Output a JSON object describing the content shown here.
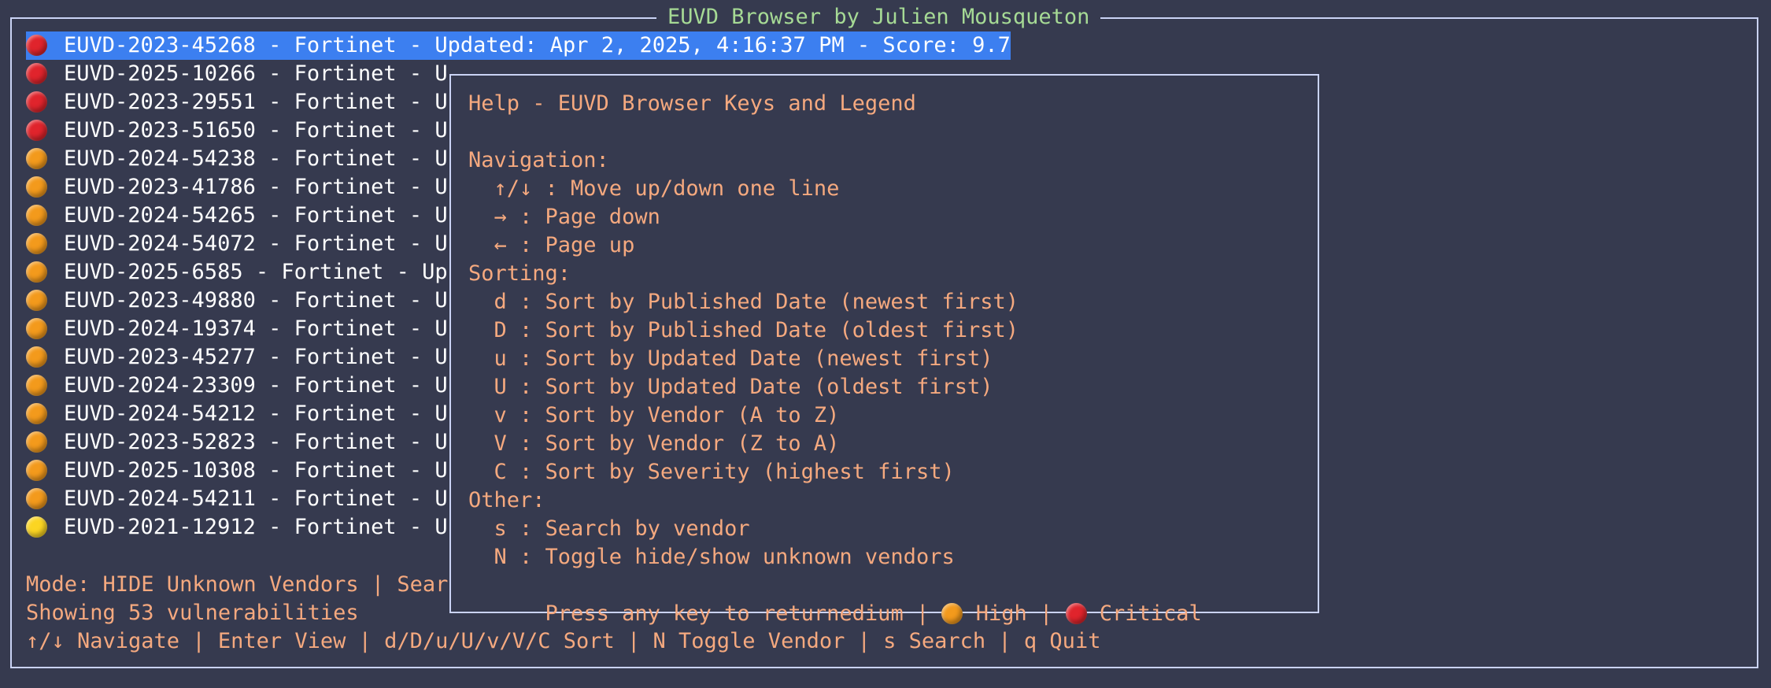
{
  "app": {
    "title": "EUVD Browser by Julien Mousqueton"
  },
  "colors": {
    "background": "#363a4f",
    "title": "#a6da95",
    "accent": "#f5a97f",
    "selection": "#3c7ff0",
    "critical": "#e0242c",
    "high": "#f39a1c",
    "medium": "#fbd522"
  },
  "list": {
    "selected_index": 0,
    "items": [
      {
        "severity": "critical",
        "icon": "red-circle-icon",
        "text": "EUVD-2023-45268 - Fortinet - Updated: Apr 2, 2025, 4:16:37 PM - Score: 9.7"
      },
      {
        "severity": "critical",
        "icon": "red-circle-icon",
        "text": "EUVD-2025-10266 - Fortinet - U"
      },
      {
        "severity": "critical",
        "icon": "red-circle-icon",
        "text": "EUVD-2023-29551 - Fortinet - U"
      },
      {
        "severity": "critical",
        "icon": "red-circle-icon",
        "text": "EUVD-2023-51650 - Fortinet - U"
      },
      {
        "severity": "high",
        "icon": "orange-circle-icon",
        "text": "EUVD-2024-54238 - Fortinet - U"
      },
      {
        "severity": "high",
        "icon": "orange-circle-icon",
        "text": "EUVD-2023-41786 - Fortinet - U"
      },
      {
        "severity": "high",
        "icon": "orange-circle-icon",
        "text": "EUVD-2024-54265 - Fortinet - U"
      },
      {
        "severity": "high",
        "icon": "orange-circle-icon",
        "text": "EUVD-2024-54072 - Fortinet - U"
      },
      {
        "severity": "high",
        "icon": "orange-circle-icon",
        "text": "EUVD-2025-6585 - Fortinet - Up"
      },
      {
        "severity": "high",
        "icon": "orange-circle-icon",
        "text": "EUVD-2023-49880 - Fortinet - U"
      },
      {
        "severity": "high",
        "icon": "orange-circle-icon",
        "text": "EUVD-2024-19374 - Fortinet - U"
      },
      {
        "severity": "high",
        "icon": "orange-circle-icon",
        "text": "EUVD-2023-45277 - Fortinet - U"
      },
      {
        "severity": "high",
        "icon": "orange-circle-icon",
        "text": "EUVD-2024-23309 - Fortinet - U"
      },
      {
        "severity": "high",
        "icon": "orange-circle-icon",
        "text": "EUVD-2024-54212 - Fortinet - U"
      },
      {
        "severity": "high",
        "icon": "orange-circle-icon",
        "text": "EUVD-2023-52823 - Fortinet - U"
      },
      {
        "severity": "high",
        "icon": "orange-circle-icon",
        "text": "EUVD-2025-10308 - Fortinet - U"
      },
      {
        "severity": "high",
        "icon": "orange-circle-icon",
        "text": "EUVD-2024-54211 - Fortinet - U"
      },
      {
        "severity": "medium",
        "icon": "yellow-circle-icon",
        "text": "EUVD-2021-12912 - Fortinet - U"
      }
    ]
  },
  "footer": {
    "mode": "Mode: HIDE Unknown Vendors | Sear",
    "count": "Showing 53 vulnerabilities",
    "keys": "↑/↓ Navigate | Enter View | d/D/u/U/v/V/C Sort | N Toggle Vendor | s Search | q Quit"
  },
  "help": {
    "title": "Help - EUVD Browser Keys and Legend",
    "navigation_header": "Navigation:",
    "navigation": [
      "  ↑/↓ : Move up/down one line",
      "  → : Page down",
      "  ← : Page up"
    ],
    "sorting_header": "Sorting:",
    "sorting": [
      "  d : Sort by Published Date (newest first)",
      "  D : Sort by Published Date (oldest first)",
      "  u : Sort by Updated Date (newest first)",
      "  U : Sort by Updated Date (oldest first)",
      "  v : Sort by Vendor (A to Z)",
      "  V : Sort by Vendor (Z to A)",
      "  C : Sort by Severity (highest first)"
    ],
    "other_header": "Other:",
    "other": [
      "  s : Search by vendor",
      "  N : Toggle hide/show unknown vendors"
    ],
    "legend_prefix": "Press any key to returnedium | ",
    "legend_high": " High | ",
    "legend_critical": " Critical"
  }
}
